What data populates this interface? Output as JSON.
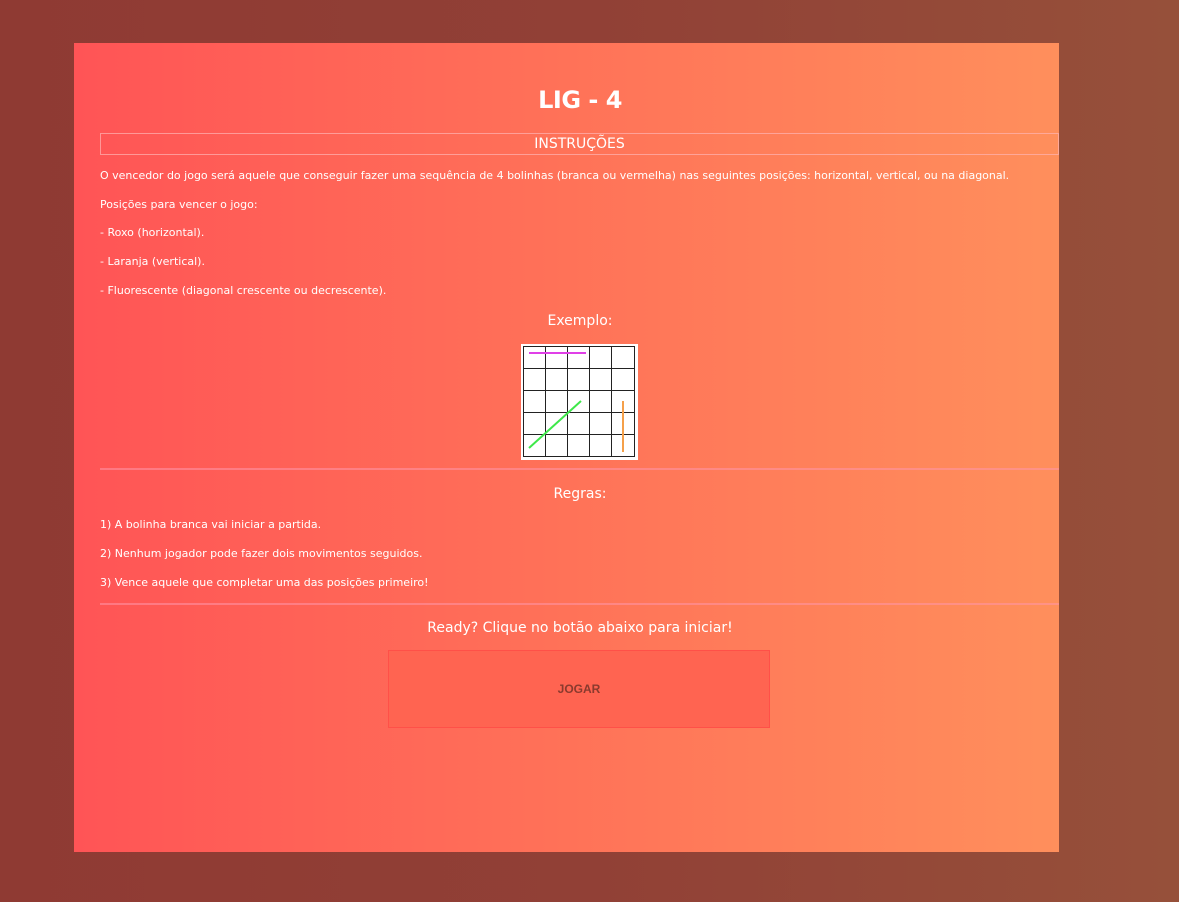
{
  "title": "LIG - 4",
  "instructions": {
    "header": "INSTRUÇÕES",
    "intro": "O vencedor do jogo será aquele que conseguir fazer uma sequência de 4 bolinhas (branca ou vermelha) nas seguintes posições: horizontal, vertical, ou na diagonal.",
    "positions_label": "Posições para vencer o jogo:",
    "positions": [
      "- Roxo (horizontal).",
      "- Laranja (vertical).",
      "- Fluorescente (diagonal crescente ou decrescente)."
    ]
  },
  "example": {
    "label": "Exemplo:",
    "board": {
      "cols": 5,
      "rows": 5
    },
    "line_colors": {
      "horizontal": "#e040e8",
      "vertical": "#f5a04a",
      "diagonal": "#3ee84a"
    }
  },
  "rules": {
    "label": "Regras:",
    "items": [
      "1) A bolinha branca vai iniciar a partida.",
      "2) Nenhum jogador pode fazer dois movimentos seguidos.",
      "3) Vence aquele que completar uma das posições primeiro!"
    ]
  },
  "cta": {
    "prompt": "Ready? Clique no botão abaixo para iniciar!",
    "button_label": "JOGAR"
  },
  "colors": {
    "gradient_start": "#ff5456",
    "gradient_end": "#ff8f5c",
    "button_bg": "#ff6451",
    "button_text": "#8a3a2e"
  }
}
